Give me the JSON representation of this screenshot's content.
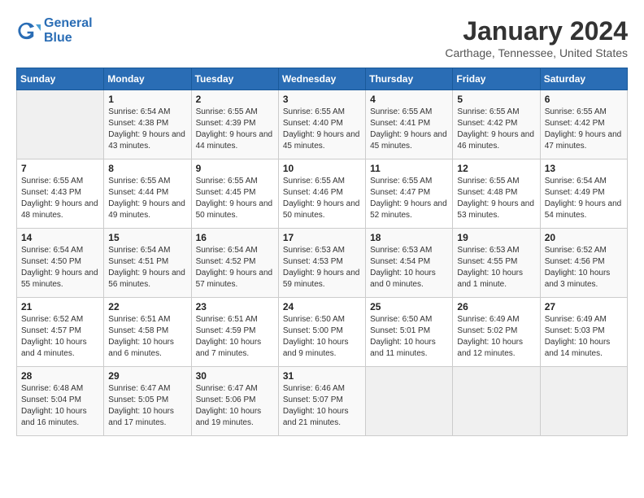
{
  "header": {
    "logo_line1": "General",
    "logo_line2": "Blue",
    "month_title": "January 2024",
    "location": "Carthage, Tennessee, United States"
  },
  "weekdays": [
    "Sunday",
    "Monday",
    "Tuesday",
    "Wednesday",
    "Thursday",
    "Friday",
    "Saturday"
  ],
  "weeks": [
    [
      {
        "day": "",
        "sunrise": "",
        "sunset": "",
        "daylight": ""
      },
      {
        "day": "1",
        "sunrise": "6:54 AM",
        "sunset": "4:38 PM",
        "daylight": "9 hours and 43 minutes."
      },
      {
        "day": "2",
        "sunrise": "6:55 AM",
        "sunset": "4:39 PM",
        "daylight": "9 hours and 44 minutes."
      },
      {
        "day": "3",
        "sunrise": "6:55 AM",
        "sunset": "4:40 PM",
        "daylight": "9 hours and 45 minutes."
      },
      {
        "day": "4",
        "sunrise": "6:55 AM",
        "sunset": "4:41 PM",
        "daylight": "9 hours and 45 minutes."
      },
      {
        "day": "5",
        "sunrise": "6:55 AM",
        "sunset": "4:42 PM",
        "daylight": "9 hours and 46 minutes."
      },
      {
        "day": "6",
        "sunrise": "6:55 AM",
        "sunset": "4:42 PM",
        "daylight": "9 hours and 47 minutes."
      }
    ],
    [
      {
        "day": "7",
        "sunrise": "6:55 AM",
        "sunset": "4:43 PM",
        "daylight": "9 hours and 48 minutes."
      },
      {
        "day": "8",
        "sunrise": "6:55 AM",
        "sunset": "4:44 PM",
        "daylight": "9 hours and 49 minutes."
      },
      {
        "day": "9",
        "sunrise": "6:55 AM",
        "sunset": "4:45 PM",
        "daylight": "9 hours and 50 minutes."
      },
      {
        "day": "10",
        "sunrise": "6:55 AM",
        "sunset": "4:46 PM",
        "daylight": "9 hours and 50 minutes."
      },
      {
        "day": "11",
        "sunrise": "6:55 AM",
        "sunset": "4:47 PM",
        "daylight": "9 hours and 52 minutes."
      },
      {
        "day": "12",
        "sunrise": "6:55 AM",
        "sunset": "4:48 PM",
        "daylight": "9 hours and 53 minutes."
      },
      {
        "day": "13",
        "sunrise": "6:54 AM",
        "sunset": "4:49 PM",
        "daylight": "9 hours and 54 minutes."
      }
    ],
    [
      {
        "day": "14",
        "sunrise": "6:54 AM",
        "sunset": "4:50 PM",
        "daylight": "9 hours and 55 minutes."
      },
      {
        "day": "15",
        "sunrise": "6:54 AM",
        "sunset": "4:51 PM",
        "daylight": "9 hours and 56 minutes."
      },
      {
        "day": "16",
        "sunrise": "6:54 AM",
        "sunset": "4:52 PM",
        "daylight": "9 hours and 57 minutes."
      },
      {
        "day": "17",
        "sunrise": "6:53 AM",
        "sunset": "4:53 PM",
        "daylight": "9 hours and 59 minutes."
      },
      {
        "day": "18",
        "sunrise": "6:53 AM",
        "sunset": "4:54 PM",
        "daylight": "10 hours and 0 minutes."
      },
      {
        "day": "19",
        "sunrise": "6:53 AM",
        "sunset": "4:55 PM",
        "daylight": "10 hours and 1 minute."
      },
      {
        "day": "20",
        "sunrise": "6:52 AM",
        "sunset": "4:56 PM",
        "daylight": "10 hours and 3 minutes."
      }
    ],
    [
      {
        "day": "21",
        "sunrise": "6:52 AM",
        "sunset": "4:57 PM",
        "daylight": "10 hours and 4 minutes."
      },
      {
        "day": "22",
        "sunrise": "6:51 AM",
        "sunset": "4:58 PM",
        "daylight": "10 hours and 6 minutes."
      },
      {
        "day": "23",
        "sunrise": "6:51 AM",
        "sunset": "4:59 PM",
        "daylight": "10 hours and 7 minutes."
      },
      {
        "day": "24",
        "sunrise": "6:50 AM",
        "sunset": "5:00 PM",
        "daylight": "10 hours and 9 minutes."
      },
      {
        "day": "25",
        "sunrise": "6:50 AM",
        "sunset": "5:01 PM",
        "daylight": "10 hours and 11 minutes."
      },
      {
        "day": "26",
        "sunrise": "6:49 AM",
        "sunset": "5:02 PM",
        "daylight": "10 hours and 12 minutes."
      },
      {
        "day": "27",
        "sunrise": "6:49 AM",
        "sunset": "5:03 PM",
        "daylight": "10 hours and 14 minutes."
      }
    ],
    [
      {
        "day": "28",
        "sunrise": "6:48 AM",
        "sunset": "5:04 PM",
        "daylight": "10 hours and 16 minutes."
      },
      {
        "day": "29",
        "sunrise": "6:47 AM",
        "sunset": "5:05 PM",
        "daylight": "10 hours and 17 minutes."
      },
      {
        "day": "30",
        "sunrise": "6:47 AM",
        "sunset": "5:06 PM",
        "daylight": "10 hours and 19 minutes."
      },
      {
        "day": "31",
        "sunrise": "6:46 AM",
        "sunset": "5:07 PM",
        "daylight": "10 hours and 21 minutes."
      },
      {
        "day": "",
        "sunrise": "",
        "sunset": "",
        "daylight": ""
      },
      {
        "day": "",
        "sunrise": "",
        "sunset": "",
        "daylight": ""
      },
      {
        "day": "",
        "sunrise": "",
        "sunset": "",
        "daylight": ""
      }
    ]
  ],
  "labels": {
    "sunrise": "Sunrise:",
    "sunset": "Sunset:",
    "daylight": "Daylight:"
  }
}
